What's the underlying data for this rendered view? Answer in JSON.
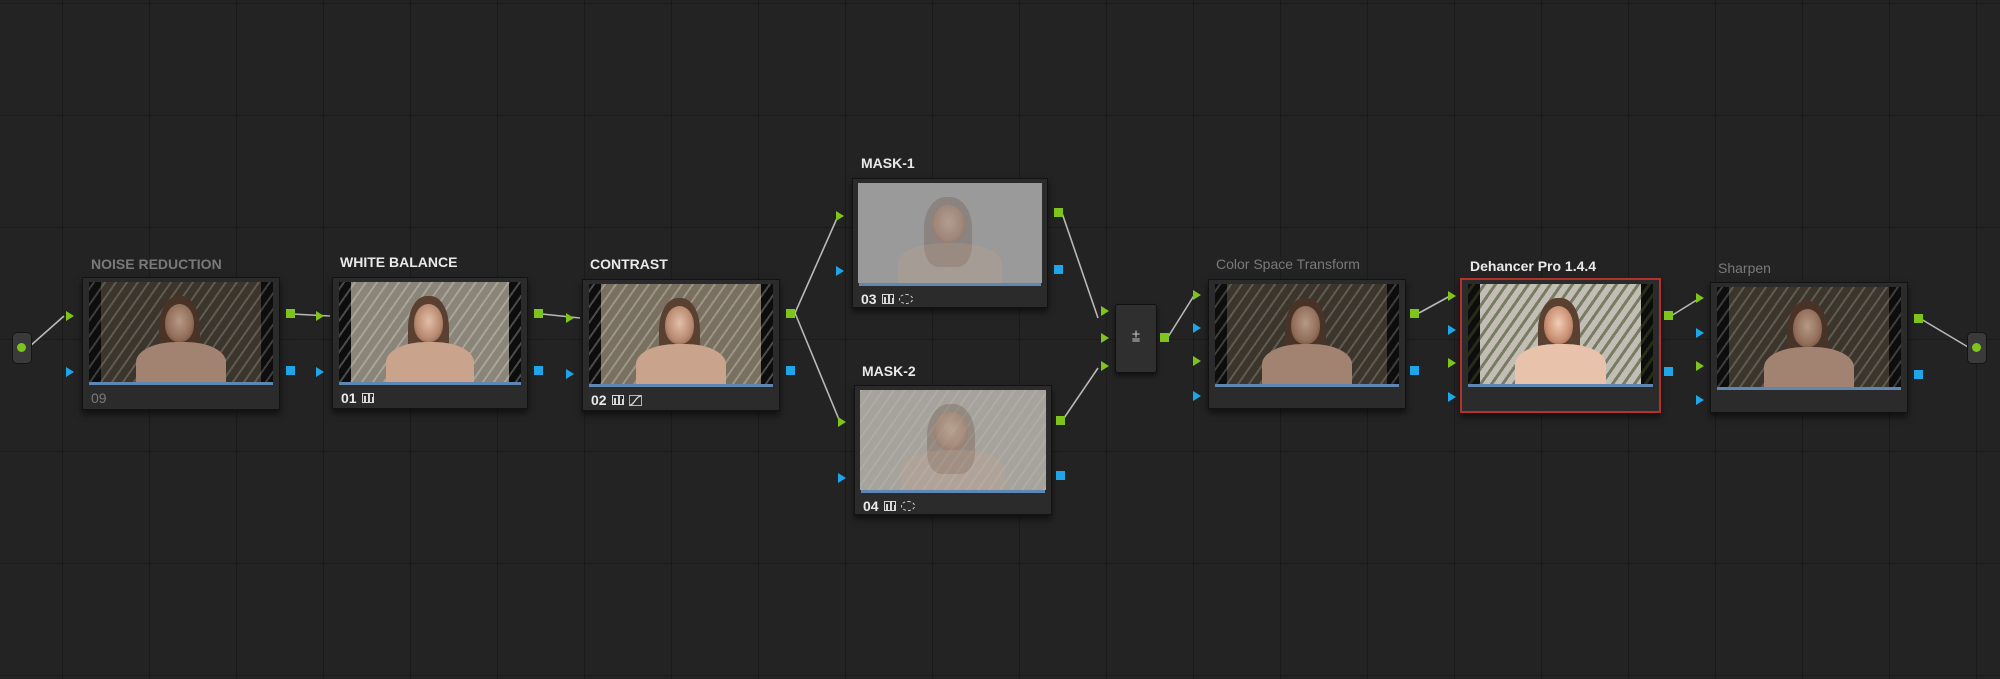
{
  "colors": {
    "background": "#232323",
    "node_body": "#2b2b2b",
    "rgb_port": "#7fc41c",
    "alpha_port": "#1fa6e8",
    "selected_outline": "#b3322b",
    "progress_bar": "#5e87b4"
  },
  "nodes": [
    {
      "id": "09",
      "label": "NOISE REDUCTION",
      "dim": true,
      "icons": []
    },
    {
      "id": "01",
      "label": "WHITE BALANCE",
      "dim": false,
      "icons": [
        "color-bars-icon"
      ]
    },
    {
      "id": "02",
      "label": "CONTRAST",
      "dim": false,
      "icons": [
        "color-bars-icon",
        "curve-icon"
      ]
    },
    {
      "id": "03",
      "label": "MASK-1",
      "dim": false,
      "icons": [
        "color-bars-icon",
        "window-circle-icon"
      ]
    },
    {
      "id": "04",
      "label": "MASK-2",
      "dim": false,
      "icons": [
        "color-bars-icon",
        "window-circle-icon"
      ]
    },
    {
      "id": "",
      "label": "Color Space Transform",
      "dim": true,
      "icons": []
    },
    {
      "id": "",
      "label": "Dehancer Pro 1.4.4",
      "dim": false,
      "selected": true,
      "icons": []
    },
    {
      "id": "",
      "label": "Sharpen",
      "dim": true,
      "icons": []
    }
  ],
  "mixer": {
    "symbol": "⩲",
    "icon": "layer-mixer-icon"
  },
  "io": {
    "source_icon": "source-input-icon",
    "output_icon": "output-icon"
  }
}
